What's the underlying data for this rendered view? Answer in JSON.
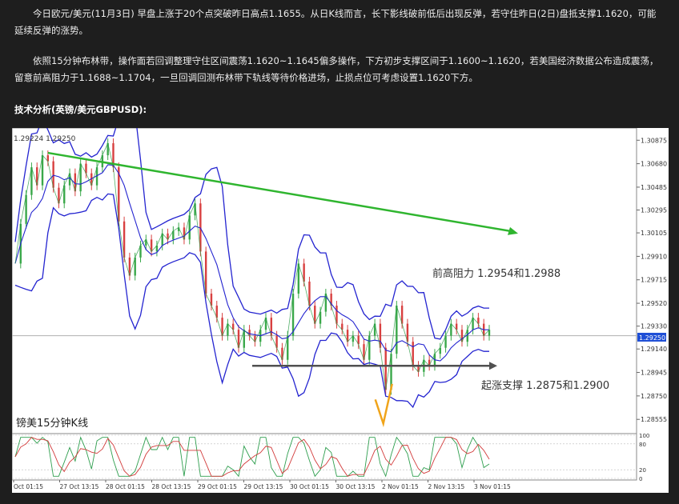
{
  "article": {
    "paragraph1": "今日欧元/美元(11月3日) 早盘上涨于20个点突破昨日高点1.1655。从日K线而言，长下影线破前低后出现反弹，若守住昨日(2日)盘抵支撑1.1620，可能延续反弹的涨势。",
    "paragraph2": "依照15分钟布林带，操作面若回调整理守住区间震荡1.1620~1.1645偏多操作，下方初步支撑区间于1.1600~1.1620，若美国经济数据公布造成震荡，留意前高阻力于1.1688~1.1704，一旦回调回测布林带下轨线等待价格进场，止损点位可考虑设置1.1620下方。",
    "heading": "技术分析(英镑/美元GBPUSD):"
  },
  "chart_data": {
    "type": "line",
    "title": "镑美15分钟K线",
    "header_values": "1.29224 1.29250",
    "current_price": "1.29250",
    "y_ticks": [
      "1.30875",
      "1.30680",
      "1.30485",
      "1.30295",
      "1.30105",
      "1.29910",
      "1.29715",
      "1.29520",
      "1.29330",
      "1.29140",
      "1.28945",
      "1.28750",
      "1.28555"
    ],
    "ylim": [
      1.2845,
      1.3095
    ],
    "x_ticks": [
      "Oct 01:15",
      "27 Oct 13:15",
      "28 Oct 01:15",
      "28 Oct 13:15",
      "29 Oct 01:15",
      "29 Oct 13:15",
      "30 Oct 01:15",
      "30 Oct 13:15",
      "2 Nov 01:15",
      "2 Nov 13:15",
      "3 Nov 01:15"
    ],
    "series": [
      {
        "name": "price",
        "values": [
          1.2985,
          1.3018,
          1.3042,
          1.3065,
          1.305,
          1.3075,
          1.307,
          1.3048,
          1.3035,
          1.305,
          1.306,
          1.3045,
          1.3068,
          1.306,
          1.305,
          1.3065,
          1.3075,
          1.3085,
          1.3065,
          1.302,
          1.299,
          1.2975,
          1.299,
          1.3,
          1.3005,
          1.2995,
          1.3,
          1.301,
          1.3005,
          1.3012,
          1.3015,
          1.3005,
          1.3025,
          1.3035,
          1.2995,
          1.296,
          1.295,
          1.294,
          1.2925,
          1.2935,
          1.293,
          1.2915,
          1.293,
          1.2925,
          1.292,
          1.293,
          1.294,
          1.2925,
          1.2915,
          1.2905,
          1.2925,
          1.296,
          1.2985,
          1.297,
          1.295,
          1.2935,
          1.2945,
          1.296,
          1.295,
          1.2935,
          1.293,
          1.292,
          1.2925,
          1.2918,
          1.2905,
          1.2925,
          1.2935,
          1.2915,
          1.288,
          1.291,
          1.295,
          1.2935,
          1.292,
          1.29,
          1.2895,
          1.2905,
          1.29,
          1.291,
          1.2915,
          1.2925,
          1.2935,
          1.293,
          1.292,
          1.293,
          1.294,
          1.2935,
          1.2925,
          1.293
        ]
      }
    ],
    "annotations": {
      "resistance_label": "前高阻力 1.2954和1.2988",
      "support_label": "起涨支撑 1.2875和1.2900",
      "resistance_line": {
        "from": [
          1.3077,
          1.3012
        ],
        "color": "#2fb52f"
      },
      "support_line": {
        "level": 1.29,
        "color": "#505050"
      }
    },
    "indicator": {
      "levels": [
        "100",
        "80",
        "20",
        "0"
      ]
    },
    "colors": {
      "price": "#1f1fc8",
      "bollinger": "#2424d0",
      "resistance": "#2fb52f",
      "support": "#505050",
      "v_pattern": "#f0a41a",
      "stoch_red": "#d23a3a",
      "stoch_green": "#2e9e4e"
    }
  }
}
